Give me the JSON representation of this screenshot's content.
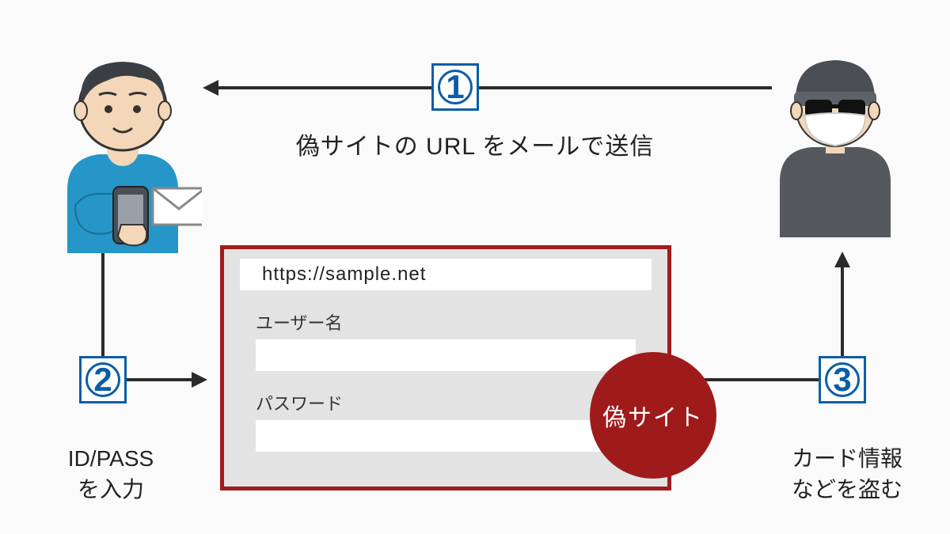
{
  "steps": {
    "one": {
      "num": "1",
      "text": "偽サイトの URL をメールで送信"
    },
    "two": {
      "num": "2",
      "line1": "ID/PASS",
      "line2": "を入力"
    },
    "three": {
      "num": "3",
      "line1": "カード情報",
      "line2": "などを盗む"
    }
  },
  "panel": {
    "url": "https://sample.net",
    "username_label": "ユーザー名",
    "password_label": "パスワード",
    "stamp": "偽サイト"
  },
  "icons": {
    "victim": "victim-person",
    "attacker": "attacker-person",
    "envelope": "envelope"
  }
}
